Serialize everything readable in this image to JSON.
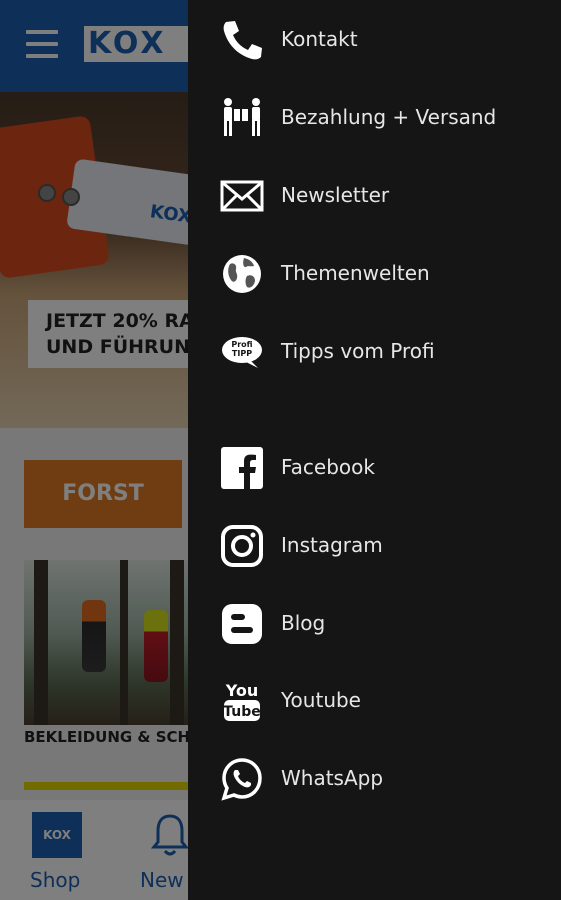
{
  "app": {
    "logo_text": "KOX",
    "hero_line1": "JETZT 20% RA",
    "hero_line2": "UND FÜHRUN",
    "saw_bar_text": "KOX",
    "category_button": "FORST",
    "product_caption": "BEKLEIDUNG & SCH",
    "bottom_nav": {
      "shop_logo": "KOX",
      "shop_label": "Shop",
      "news_label": "New"
    }
  },
  "drawer": {
    "items": [
      {
        "label": "Kontakt",
        "icon": "phone-icon"
      },
      {
        "label": "Bezahlung + Versand",
        "icon": "delivery-icon"
      },
      {
        "label": "Newsletter",
        "icon": "envelope-icon"
      },
      {
        "label": "Themenwelten",
        "icon": "globe-icon"
      },
      {
        "label": "Tipps vom Profi",
        "icon": "profi-tipp-icon",
        "icon_text_1": "Profi",
        "icon_text_2": "TIPP"
      }
    ],
    "social": [
      {
        "label": "Facebook",
        "icon": "facebook-icon"
      },
      {
        "label": "Instagram",
        "icon": "instagram-icon"
      },
      {
        "label": "Blog",
        "icon": "blogger-icon"
      },
      {
        "label": "Youtube",
        "icon": "youtube-icon",
        "icon_text_1": "You",
        "icon_text_2": "Tube"
      },
      {
        "label": "WhatsApp",
        "icon": "whatsapp-icon"
      }
    ]
  },
  "colors": {
    "brand_blue": "#1d5fb0",
    "drawer_bg": "#151515",
    "drawer_text": "#e6e6e6",
    "forst_orange": "#e07a26"
  }
}
